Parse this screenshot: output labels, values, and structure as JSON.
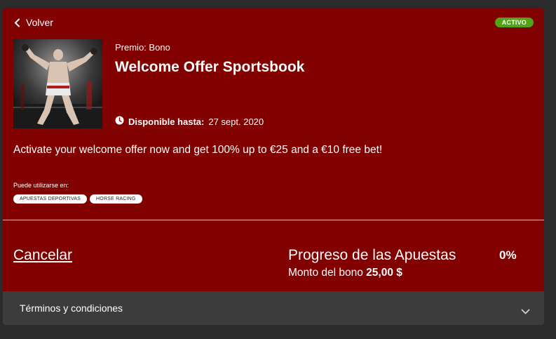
{
  "header": {
    "back_label": "Volver",
    "status_badge": "ACTIVO",
    "status_color": "#53a318"
  },
  "offer": {
    "prize_label": "Premio:",
    "prize_value": "Bono",
    "title": "Welcome Offer Sportsbook",
    "available_label": "Disponible hasta:",
    "available_date": "27 sept. 2020",
    "description": "Activate your welcome offer now and get 100% up to €25 and a €10 free bet!",
    "usable_in_label": "Puede utilizarse en:",
    "tags": [
      "APUESTAS DEPORTIVAS",
      "HORSE RACING"
    ]
  },
  "footer": {
    "cancel_label": "Cancelar",
    "progress_label": "Progreso de las Apuestas",
    "progress_value": "0%",
    "bonus_amount_label": "Monto del bono",
    "bonus_amount_value": "25,00 $"
  },
  "terms": {
    "label": "Términos y condiciones"
  },
  "colors": {
    "card_background": "#810000",
    "terms_background": "#3c3c3c",
    "page_background": "#2b2b2b"
  },
  "icons": {
    "back": "chevron-left-icon",
    "clock": "clock-icon",
    "terms": "chevron-down-icon"
  }
}
